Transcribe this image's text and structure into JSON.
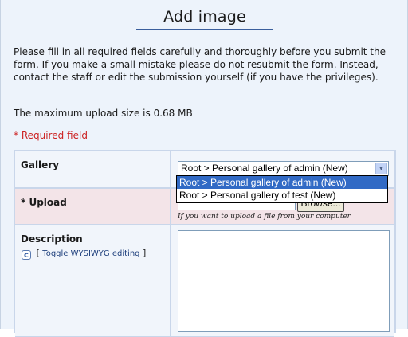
{
  "page": {
    "title": "Add image",
    "intro": "Please fill in all required fields carefully and thoroughly before you submit the form. If you make a small mistake please do not resubmit the form. Instead, contact the staff or edit the submission yourself (if you have the privileges).",
    "max_upload": "The maximum upload size is 0.68 MB",
    "required_note": "* Required field"
  },
  "form": {
    "gallery": {
      "label": "Gallery",
      "selected": "Root > Personal gallery of admin (New)",
      "options": [
        "Root > Personal gallery of admin (New)",
        "Root > Personal gallery of test (New)"
      ],
      "arrow_icon": "chevron-down-icon"
    },
    "upload": {
      "label": "* Upload",
      "browse_label": "Browse...",
      "hint": "If you want to upload a file from your computer"
    },
    "description": {
      "label": "Description",
      "toggle_prefix": "[",
      "toggle_link": "Toggle WYSIWYG editing",
      "toggle_suffix": "]",
      "editor_icon": "c-icon"
    }
  },
  "colors": {
    "background": "#edf3fb",
    "title_underline": "#3a5e9c",
    "required": "#cc2222",
    "upload_row": "#f3e4e8",
    "selected_option": "#316ac5"
  }
}
